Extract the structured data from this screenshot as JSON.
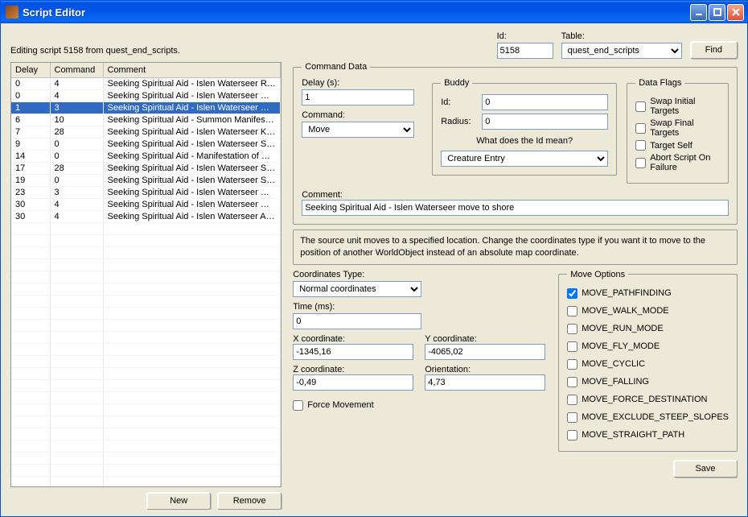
{
  "window": {
    "title": "Script Editor"
  },
  "top": {
    "editing_text": "Editing script 5158 from quest_end_scripts.",
    "id_label": "Id:",
    "id_value": "5158",
    "table_label": "Table:",
    "table_value": "quest_end_scripts",
    "find_label": "Find"
  },
  "table": {
    "headers": {
      "delay": "Delay",
      "command": "Command",
      "comment": "Comment"
    },
    "rows": [
      {
        "delay": "0",
        "command": "4",
        "comment": "Seeking Spiritual Aid - Islen Waterseer Remov...",
        "sel": false
      },
      {
        "delay": "0",
        "command": "4",
        "comment": "Seeking Spiritual Aid - Islen Waterseer make ...",
        "sel": false
      },
      {
        "delay": "1",
        "command": "3",
        "comment": "Seeking Spiritual Aid - Islen Waterseer move t...",
        "sel": true
      },
      {
        "delay": "6",
        "command": "10",
        "comment": "Seeking Spiritual Aid - Summon Manifestation ...",
        "sel": false
      },
      {
        "delay": "7",
        "command": "28",
        "comment": "Seeking Spiritual Aid - Islen Waterseer Kneel",
        "sel": false
      },
      {
        "delay": "9",
        "command": "0",
        "comment": "Seeking Spiritual Aid - Islen Waterseer Say Te...",
        "sel": false
      },
      {
        "delay": "14",
        "command": "0",
        "comment": "Seeking Spiritual Aid - Manifestation of Water ...",
        "sel": false
      },
      {
        "delay": "17",
        "command": "28",
        "comment": "Seeking Spiritual Aid - Islen Waterseer Stand",
        "sel": false
      },
      {
        "delay": "19",
        "command": "0",
        "comment": "Seeking Spiritual Aid - Islen Waterseer Say Te...",
        "sel": false
      },
      {
        "delay": "23",
        "command": "3",
        "comment": "Seeking Spiritual Aid - Islen Waterseer move t...",
        "sel": false
      },
      {
        "delay": "30",
        "command": "4",
        "comment": "Seeking Spiritual Aid - Islen Waterseer make T...",
        "sel": false
      },
      {
        "delay": "30",
        "command": "4",
        "comment": "Seeking Spiritual Aid - Islen Waterseer Add Qu...",
        "sel": false
      }
    ]
  },
  "buttons": {
    "new": "New",
    "remove": "Remove",
    "save": "Save"
  },
  "cmd": {
    "legend": "Command Data",
    "delay_label": "Delay (s):",
    "delay_value": "1",
    "command_label": "Command:",
    "command_value": "Move",
    "comment_label": "Comment:",
    "comment_value": "Seeking Spiritual Aid - Islen Waterseer move to shore"
  },
  "buddy": {
    "legend": "Buddy",
    "id_label": "Id:",
    "id_value": "0",
    "radius_label": "Radius:",
    "radius_value": "0",
    "meaning_label": "What does the Id mean?",
    "meaning_value": "Creature Entry"
  },
  "flags": {
    "legend": "Data Flags",
    "items": [
      "Swap Initial Targets",
      "Swap Final Targets",
      "Target Self",
      "Abort Script On Failure"
    ]
  },
  "desc": "The source unit moves to a specified location. Change the coordinates type if you want it to move to the position of another WorldObject instead of an absolute map coordinate.",
  "coords": {
    "type_label": "Coordinates Type:",
    "type_value": "Normal coordinates",
    "time_label": "Time (ms):",
    "time_value": "0",
    "x_label": "X coordinate:",
    "x_value": "-1345,16",
    "y_label": "Y coordinate:",
    "y_value": "-4065,02",
    "z_label": "Z coordinate:",
    "z_value": "-0,49",
    "o_label": "Orientation:",
    "o_value": "4,73",
    "force_label": "Force Movement"
  },
  "moveopt": {
    "legend": "Move Options",
    "items": [
      {
        "label": "MOVE_PATHFINDING",
        "checked": true
      },
      {
        "label": "MOVE_WALK_MODE",
        "checked": false
      },
      {
        "label": "MOVE_RUN_MODE",
        "checked": false
      },
      {
        "label": "MOVE_FLY_MODE",
        "checked": false
      },
      {
        "label": "MOVE_CYCLIC",
        "checked": false
      },
      {
        "label": "MOVE_FALLING",
        "checked": false
      },
      {
        "label": "MOVE_FORCE_DESTINATION",
        "checked": false
      },
      {
        "label": "MOVE_EXCLUDE_STEEP_SLOPES",
        "checked": false
      },
      {
        "label": "MOVE_STRAIGHT_PATH",
        "checked": false
      }
    ]
  }
}
